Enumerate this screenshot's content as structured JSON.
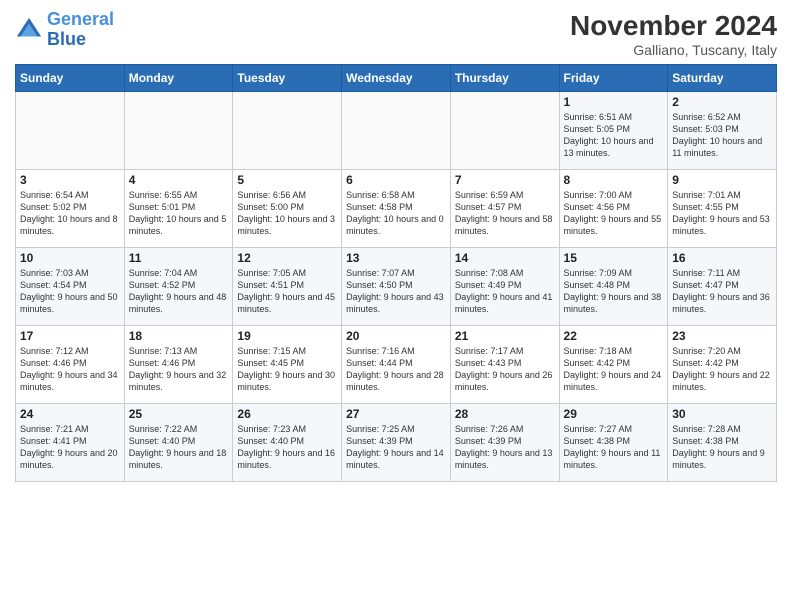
{
  "logo": {
    "line1": "General",
    "line2": "Blue"
  },
  "title": "November 2024",
  "location": "Galliano, Tuscany, Italy",
  "days_of_week": [
    "Sunday",
    "Monday",
    "Tuesday",
    "Wednesday",
    "Thursday",
    "Friday",
    "Saturday"
  ],
  "weeks": [
    [
      {
        "day": "",
        "info": ""
      },
      {
        "day": "",
        "info": ""
      },
      {
        "day": "",
        "info": ""
      },
      {
        "day": "",
        "info": ""
      },
      {
        "day": "",
        "info": ""
      },
      {
        "day": "1",
        "info": "Sunrise: 6:51 AM\nSunset: 5:05 PM\nDaylight: 10 hours and 13 minutes."
      },
      {
        "day": "2",
        "info": "Sunrise: 6:52 AM\nSunset: 5:03 PM\nDaylight: 10 hours and 11 minutes."
      }
    ],
    [
      {
        "day": "3",
        "info": "Sunrise: 6:54 AM\nSunset: 5:02 PM\nDaylight: 10 hours and 8 minutes."
      },
      {
        "day": "4",
        "info": "Sunrise: 6:55 AM\nSunset: 5:01 PM\nDaylight: 10 hours and 5 minutes."
      },
      {
        "day": "5",
        "info": "Sunrise: 6:56 AM\nSunset: 5:00 PM\nDaylight: 10 hours and 3 minutes."
      },
      {
        "day": "6",
        "info": "Sunrise: 6:58 AM\nSunset: 4:58 PM\nDaylight: 10 hours and 0 minutes."
      },
      {
        "day": "7",
        "info": "Sunrise: 6:59 AM\nSunset: 4:57 PM\nDaylight: 9 hours and 58 minutes."
      },
      {
        "day": "8",
        "info": "Sunrise: 7:00 AM\nSunset: 4:56 PM\nDaylight: 9 hours and 55 minutes."
      },
      {
        "day": "9",
        "info": "Sunrise: 7:01 AM\nSunset: 4:55 PM\nDaylight: 9 hours and 53 minutes."
      }
    ],
    [
      {
        "day": "10",
        "info": "Sunrise: 7:03 AM\nSunset: 4:54 PM\nDaylight: 9 hours and 50 minutes."
      },
      {
        "day": "11",
        "info": "Sunrise: 7:04 AM\nSunset: 4:52 PM\nDaylight: 9 hours and 48 minutes."
      },
      {
        "day": "12",
        "info": "Sunrise: 7:05 AM\nSunset: 4:51 PM\nDaylight: 9 hours and 45 minutes."
      },
      {
        "day": "13",
        "info": "Sunrise: 7:07 AM\nSunset: 4:50 PM\nDaylight: 9 hours and 43 minutes."
      },
      {
        "day": "14",
        "info": "Sunrise: 7:08 AM\nSunset: 4:49 PM\nDaylight: 9 hours and 41 minutes."
      },
      {
        "day": "15",
        "info": "Sunrise: 7:09 AM\nSunset: 4:48 PM\nDaylight: 9 hours and 38 minutes."
      },
      {
        "day": "16",
        "info": "Sunrise: 7:11 AM\nSunset: 4:47 PM\nDaylight: 9 hours and 36 minutes."
      }
    ],
    [
      {
        "day": "17",
        "info": "Sunrise: 7:12 AM\nSunset: 4:46 PM\nDaylight: 9 hours and 34 minutes."
      },
      {
        "day": "18",
        "info": "Sunrise: 7:13 AM\nSunset: 4:46 PM\nDaylight: 9 hours and 32 minutes."
      },
      {
        "day": "19",
        "info": "Sunrise: 7:15 AM\nSunset: 4:45 PM\nDaylight: 9 hours and 30 minutes."
      },
      {
        "day": "20",
        "info": "Sunrise: 7:16 AM\nSunset: 4:44 PM\nDaylight: 9 hours and 28 minutes."
      },
      {
        "day": "21",
        "info": "Sunrise: 7:17 AM\nSunset: 4:43 PM\nDaylight: 9 hours and 26 minutes."
      },
      {
        "day": "22",
        "info": "Sunrise: 7:18 AM\nSunset: 4:42 PM\nDaylight: 9 hours and 24 minutes."
      },
      {
        "day": "23",
        "info": "Sunrise: 7:20 AM\nSunset: 4:42 PM\nDaylight: 9 hours and 22 minutes."
      }
    ],
    [
      {
        "day": "24",
        "info": "Sunrise: 7:21 AM\nSunset: 4:41 PM\nDaylight: 9 hours and 20 minutes."
      },
      {
        "day": "25",
        "info": "Sunrise: 7:22 AM\nSunset: 4:40 PM\nDaylight: 9 hours and 18 minutes."
      },
      {
        "day": "26",
        "info": "Sunrise: 7:23 AM\nSunset: 4:40 PM\nDaylight: 9 hours and 16 minutes."
      },
      {
        "day": "27",
        "info": "Sunrise: 7:25 AM\nSunset: 4:39 PM\nDaylight: 9 hours and 14 minutes."
      },
      {
        "day": "28",
        "info": "Sunrise: 7:26 AM\nSunset: 4:39 PM\nDaylight: 9 hours and 13 minutes."
      },
      {
        "day": "29",
        "info": "Sunrise: 7:27 AM\nSunset: 4:38 PM\nDaylight: 9 hours and 11 minutes."
      },
      {
        "day": "30",
        "info": "Sunrise: 7:28 AM\nSunset: 4:38 PM\nDaylight: 9 hours and 9 minutes."
      }
    ]
  ]
}
